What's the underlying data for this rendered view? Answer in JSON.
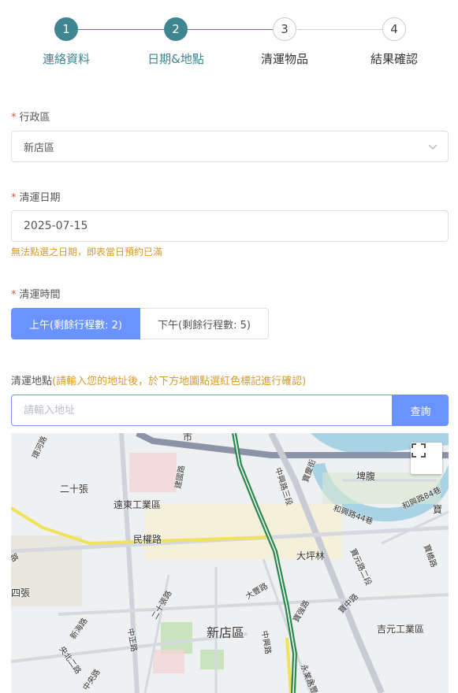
{
  "stepper": {
    "steps": [
      {
        "number": "1",
        "label": "連絡資料",
        "state": "done"
      },
      {
        "number": "2",
        "label": "日期&地點",
        "state": "done"
      },
      {
        "number": "3",
        "label": "清運物品",
        "state": "todo"
      },
      {
        "number": "4",
        "label": "結果確認",
        "state": "todo"
      }
    ],
    "colors": {
      "done": "#3f8690",
      "todo": "#cccccc"
    }
  },
  "district": {
    "required_mark": "*",
    "label": "行政區",
    "value": "新店區",
    "icon": "chevron-down-icon"
  },
  "date": {
    "required_mark": "*",
    "label": "清運日期",
    "value": "2025-07-15",
    "hint": "無法點選之日期，即表當日預約已滿"
  },
  "time": {
    "required_mark": "*",
    "label": "清運時間",
    "options": [
      {
        "label": "上午(剩餘行程數: 2)",
        "selected": true
      },
      {
        "label": "下午(剩餘行程數: 5)",
        "selected": false
      }
    ]
  },
  "location": {
    "label": "清運地點",
    "note": "(請輸入您的地址後，於下方地圖點選紅色標記進行確認)",
    "placeholder": "請輸入地址",
    "value": "",
    "search_label": "查詢"
  },
  "map": {
    "fullscreen_icon": "fullscreen-icon",
    "labels": {
      "city_top": "市",
      "huanhe": "環河路",
      "ershizhang": "二十張",
      "yuandong": "遠東工業區",
      "jianguo": "建國路",
      "zhongxing3": "中興路三段",
      "baoqiao_st": "寶慶街",
      "bifu": "埤腹",
      "hexing44": "和興路44巷",
      "hexing84": "和興路84巷",
      "bao_right": "寶",
      "minquan": "民權路",
      "road_left": "路",
      "dapinglin": "大坪林",
      "baoyuan2": "寶元路二段",
      "baoqiao_rd": "寶橋路",
      "sizhang": "四張",
      "ershizhang_rd": "二十張路",
      "dafeng": "大豐路",
      "baoqiang": "寶強路",
      "baozhong": "寶中路",
      "xinhai": "新海路",
      "zhongzheng": "中正路",
      "xindian": "新店區",
      "zhongxing_rd": "中興路",
      "jiyuan": "吉元工業區",
      "yangnan": "央北二路",
      "zhongyang": "中央路",
      "yongye": "永業路",
      "yongfeng": "永豐街"
    }
  }
}
